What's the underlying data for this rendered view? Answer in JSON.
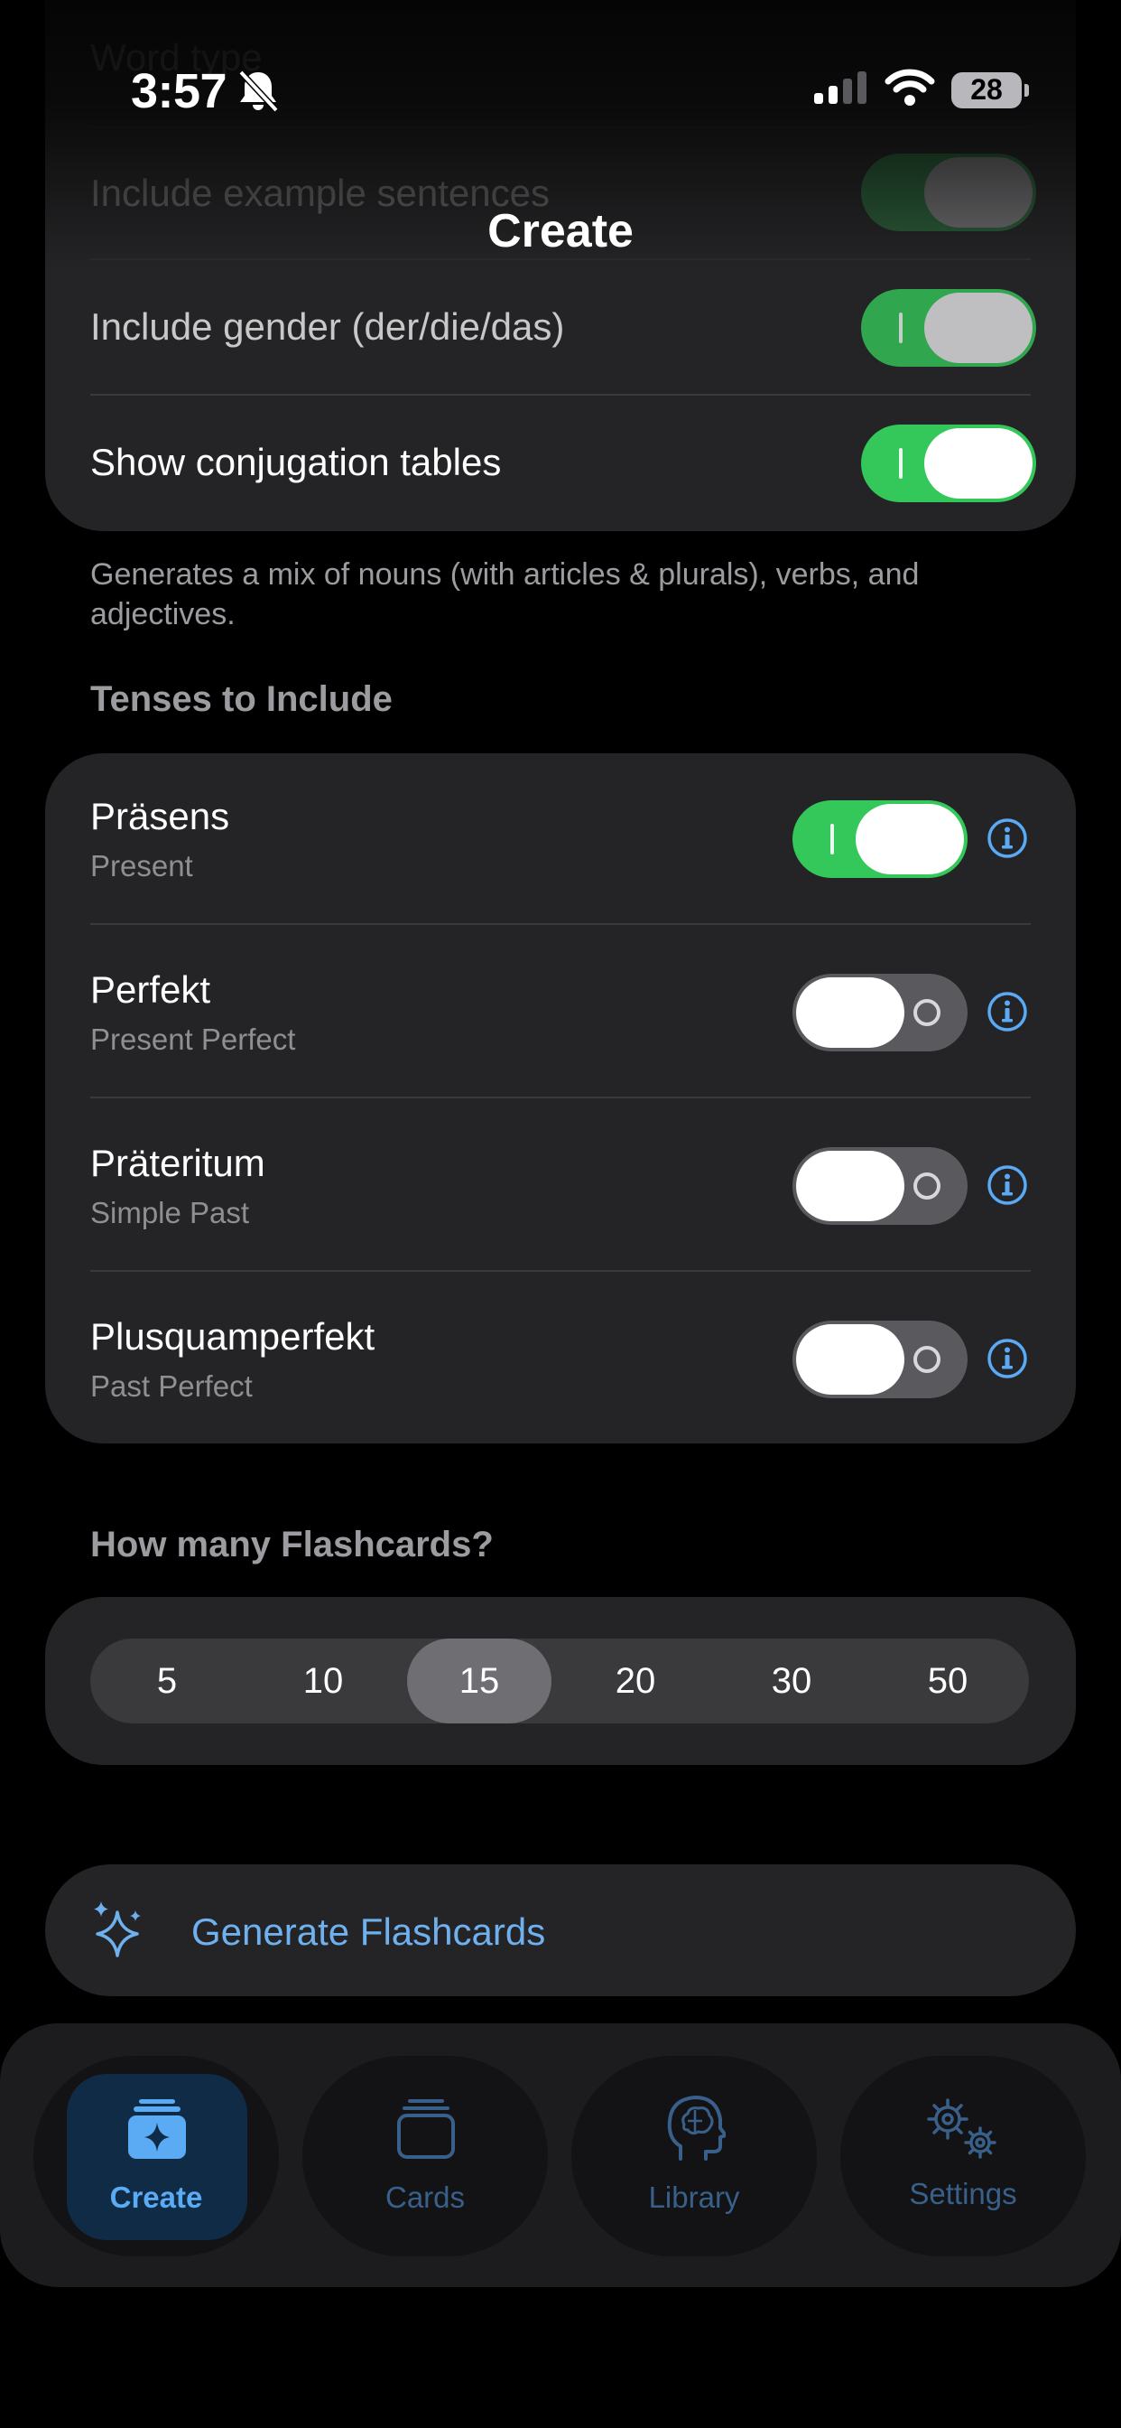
{
  "status_bar": {
    "time": "3:57",
    "battery": "28"
  },
  "nav": {
    "title": "Create",
    "behind_rows": [
      "Word type",
      "Include example sentences"
    ]
  },
  "options": {
    "gender": {
      "label": "Include gender (der/die/das)",
      "on": true
    },
    "conjugation": {
      "label": "Show conjugation tables",
      "on": true
    },
    "footnote": "Generates a mix of nouns (with articles & plurals), verbs, and adjectives."
  },
  "tenses": {
    "header": "Tenses to Include",
    "items": [
      {
        "label": "Präsens",
        "sub": "Present",
        "on": true
      },
      {
        "label": "Perfekt",
        "sub": "Present Perfect",
        "on": false
      },
      {
        "label": "Präteritum",
        "sub": "Simple Past",
        "on": false
      },
      {
        "label": "Plusquamperfekt",
        "sub": "Past Perfect",
        "on": false
      }
    ]
  },
  "count": {
    "header": "How many Flashcards?",
    "options": [
      "5",
      "10",
      "15",
      "20",
      "30",
      "50"
    ],
    "selected": "15"
  },
  "generate": {
    "label": "Generate Flashcards"
  },
  "tabbar": {
    "tabs": [
      {
        "label": "Create",
        "icon": "create-cards-sparkle-icon",
        "active": true
      },
      {
        "label": "Cards",
        "icon": "cards-stack-icon",
        "active": false
      },
      {
        "label": "Library",
        "icon": "brain-head-icon",
        "active": false
      },
      {
        "label": "Settings",
        "icon": "gears-icon",
        "active": false
      }
    ]
  },
  "colors": {
    "background": "#000000",
    "card": "#242426",
    "toggle_on": "#34c759",
    "toggle_off": "#5a5a5e",
    "accent": "#5aaaf4",
    "info": "#5aaaf4"
  }
}
